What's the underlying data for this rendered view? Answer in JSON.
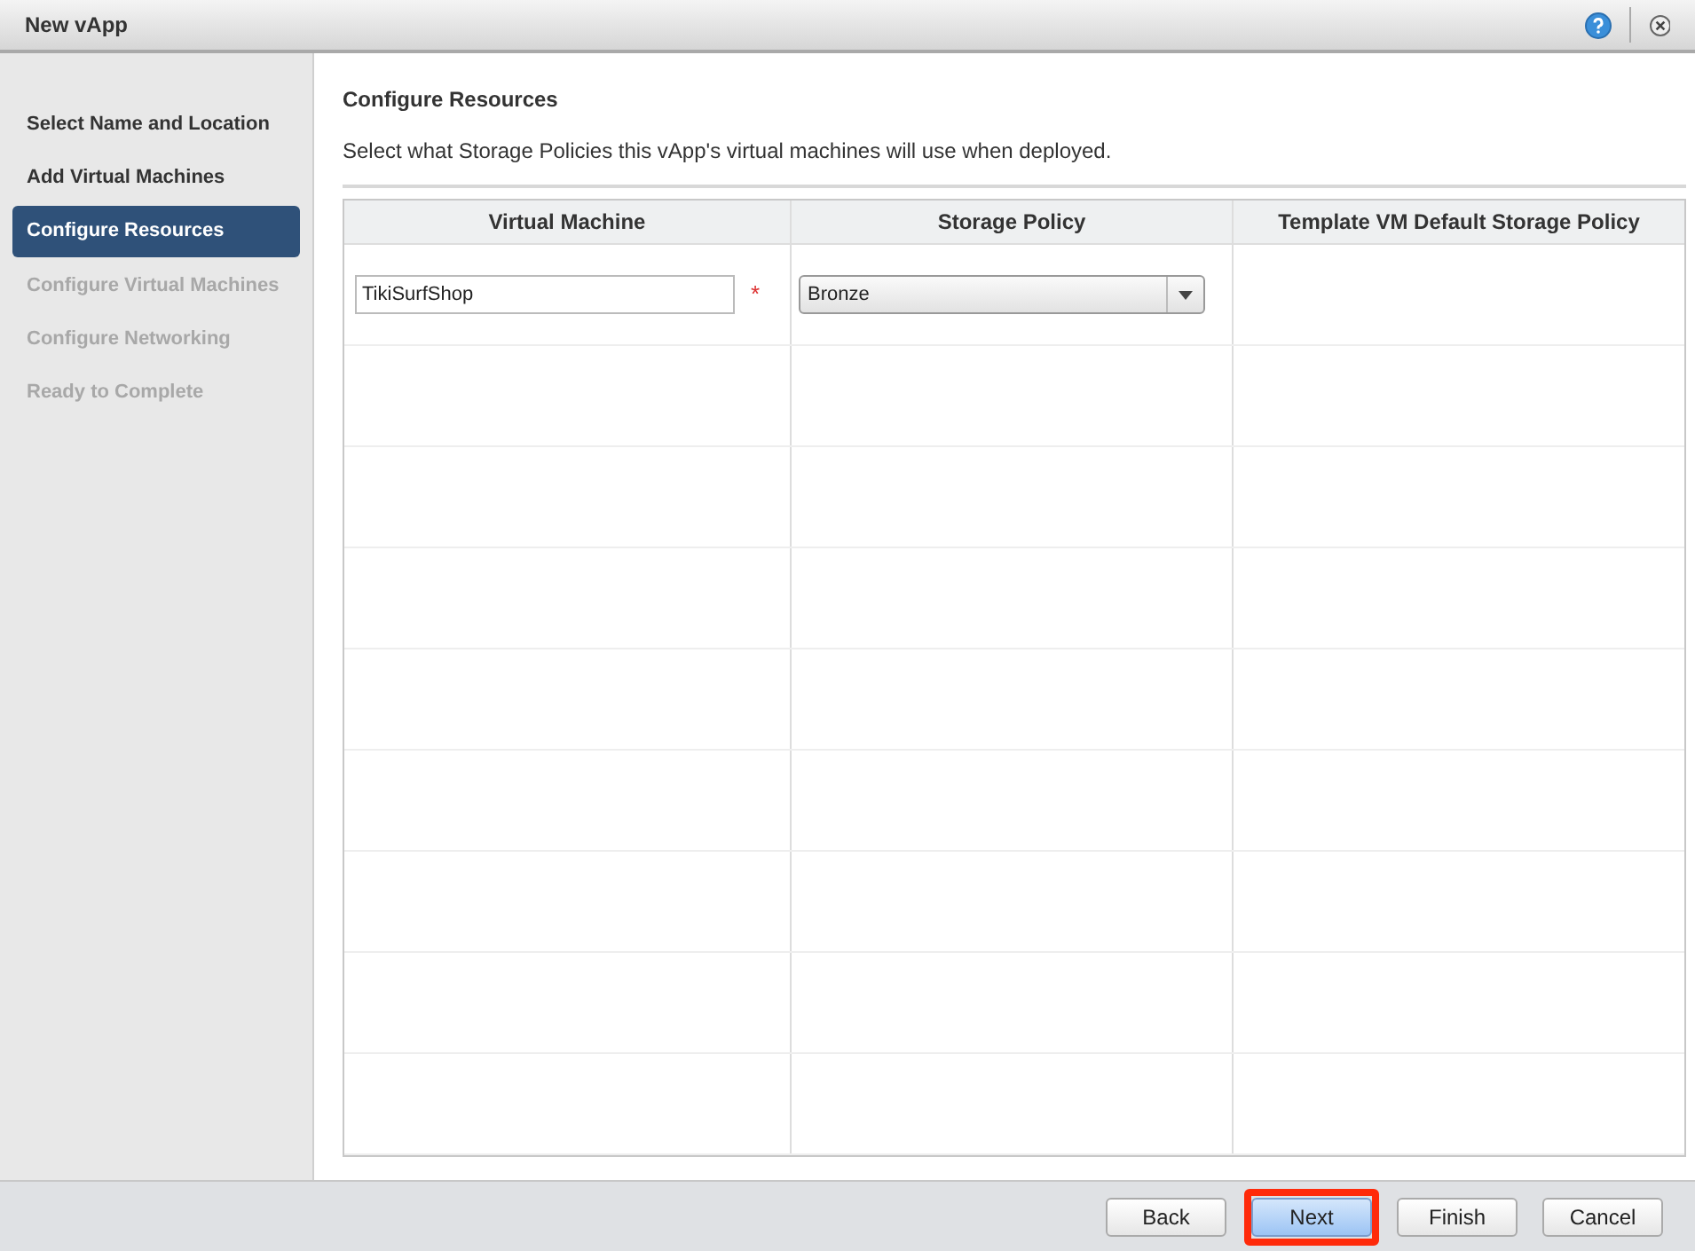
{
  "window": {
    "title": "New vApp"
  },
  "steps": [
    {
      "label": "Select Name and Location",
      "selected": false,
      "disabled": false
    },
    {
      "label": "Add Virtual Machines",
      "selected": false,
      "disabled": false
    },
    {
      "label": "Configure Resources",
      "selected": true,
      "disabled": false
    },
    {
      "label": "Configure Virtual Machines",
      "selected": false,
      "disabled": true
    },
    {
      "label": "Configure Networking",
      "selected": false,
      "disabled": true
    },
    {
      "label": "Ready to Complete",
      "selected": false,
      "disabled": true
    }
  ],
  "heading": "Configure Resources",
  "description": "Select what Storage Policies this vApp's virtual machines will use when deployed.",
  "table": {
    "columns": [
      "Virtual Machine",
      "Storage Policy",
      "Template VM Default Storage Policy"
    ],
    "rows": [
      {
        "vm_name": "TikiSurfShop",
        "required_mark": "*",
        "storage_policy": "Bronze"
      }
    ]
  },
  "buttons": [
    {
      "label": "Back",
      "selected": false,
      "highlighted": false
    },
    {
      "label": "Next",
      "selected": true,
      "highlighted": true
    },
    {
      "label": "Finish",
      "selected": false,
      "highlighted": false
    },
    {
      "label": "Cancel",
      "selected": false,
      "highlighted": false
    }
  ]
}
